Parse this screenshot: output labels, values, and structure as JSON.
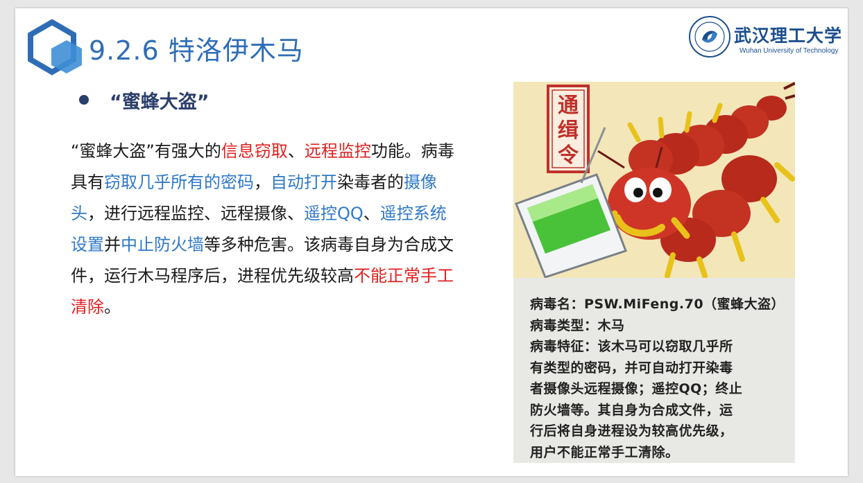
{
  "header": {
    "title": "9.2.6 特洛伊木马",
    "logo_cn": "武汉理工大学",
    "logo_en": "Wuhan University of Technology"
  },
  "bullet": {
    "text": "“蜜蜂大盗”"
  },
  "body": {
    "segments": [
      {
        "text": "“蜜蜂大盗”有强大的",
        "style": "normal"
      },
      {
        "text": "信息窃取",
        "style": "red"
      },
      {
        "text": "、",
        "style": "normal"
      },
      {
        "text": "远程监控",
        "style": "red"
      },
      {
        "text": "功能。病毒具有",
        "style": "normal"
      },
      {
        "text": "窃取几乎所有的密码",
        "style": "blue"
      },
      {
        "text": "，",
        "style": "normal"
      },
      {
        "text": "自动打开",
        "style": "blue"
      },
      {
        "text": "染毒者的",
        "style": "normal"
      },
      {
        "text": "摄像头",
        "style": "blue"
      },
      {
        "text": "，进行远程监控、远程摄像、",
        "style": "normal"
      },
      {
        "text": "遥控QQ",
        "style": "blue"
      },
      {
        "text": "、",
        "style": "normal"
      },
      {
        "text": "遥控系统设置",
        "style": "blue"
      },
      {
        "text": "并",
        "style": "normal"
      },
      {
        "text": "中止防火墙",
        "style": "blue"
      },
      {
        "text": "等多种危害。该病毒自身为合成文件，运行木马程序后，进程优先级较高",
        "style": "normal"
      },
      {
        "text": "不能正常手工清除",
        "style": "red"
      },
      {
        "text": "。",
        "style": "normal"
      }
    ]
  },
  "card": {
    "stamp_text": "通缉令",
    "caption_lines": [
      "病毒名：PSW.MiFeng.70（蜜蜂大盗）",
      "病毒类型：木马",
      "病毒特征：该木马可以窃取几乎所",
      "有类型的密码，并可自动打开染毒",
      "者摄像头远程摄像；遥控QQ；终止",
      "防火墙等。其自身为合成文件，运",
      "行后将自身进程设为较高优先级，",
      "用户不能正常手工清除。"
    ]
  },
  "colors": {
    "title_blue": "#2e6db5",
    "bullet_navy": "#2c3e6b",
    "highlight_red": "#e02020",
    "highlight_blue": "#2e78c8"
  }
}
